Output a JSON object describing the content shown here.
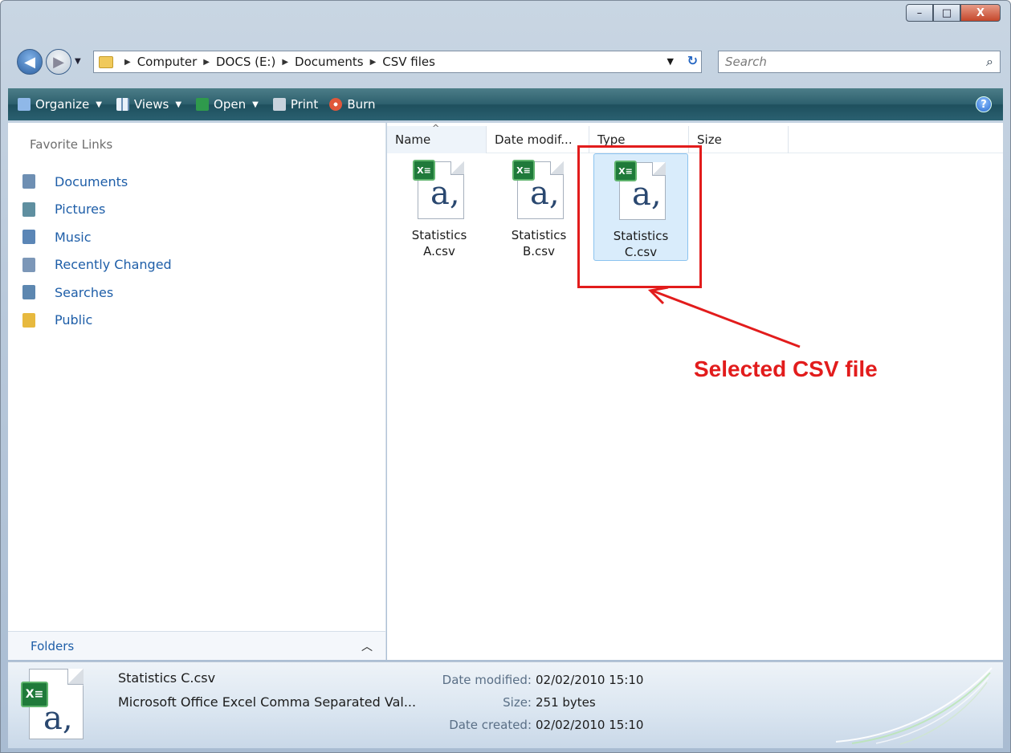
{
  "window": {
    "caption": {
      "minimize": "–",
      "maximize": "□",
      "close": "X"
    }
  },
  "nav": {
    "back_icon": "back-arrow-icon",
    "forward_icon": "forward-arrow-icon",
    "breadcrumbs": [
      "Computer",
      "DOCS (E:)",
      "Documents",
      "CSV files"
    ],
    "search_placeholder": "Search"
  },
  "toolbar": {
    "organize": "Organize",
    "views": "Views",
    "open": "Open",
    "print": "Print",
    "burn": "Burn",
    "help": "?"
  },
  "sidebar": {
    "header": "Favorite Links",
    "items": [
      {
        "label": "Documents",
        "icon": "documents-icon",
        "color": "#6e8fb3"
      },
      {
        "label": "Pictures",
        "icon": "pictures-icon",
        "color": "#5f8fa0"
      },
      {
        "label": "Music",
        "icon": "music-icon",
        "color": "#5b86b6"
      },
      {
        "label": "Recently Changed",
        "icon": "recent-icon",
        "color": "#7c97b8"
      },
      {
        "label": "Searches",
        "icon": "searches-icon",
        "color": "#5d87b0"
      },
      {
        "label": "Public",
        "icon": "folder-icon",
        "color": "#e7b93e"
      }
    ],
    "folders_label": "Folders"
  },
  "columns": [
    "Name",
    "Date modif...",
    "Type",
    "Size"
  ],
  "files": [
    {
      "line1": "Statistics",
      "line2": "A.csv",
      "selected": false
    },
    {
      "line1": "Statistics",
      "line2": "B.csv",
      "selected": false
    },
    {
      "line1": "Statistics",
      "line2": "C.csv",
      "selected": true
    }
  ],
  "annotation": {
    "text": "Selected CSV file",
    "color": "#e21c1c"
  },
  "details": {
    "name": "Statistics C.csv",
    "type": "Microsoft Office Excel Comma Separated Val...",
    "date_modified_label": "Date modified:",
    "date_modified": "02/02/2010 15:10",
    "size_label": "Size:",
    "size": "251 bytes",
    "date_created_label": "Date created:",
    "date_created": "02/02/2010 15:10"
  }
}
